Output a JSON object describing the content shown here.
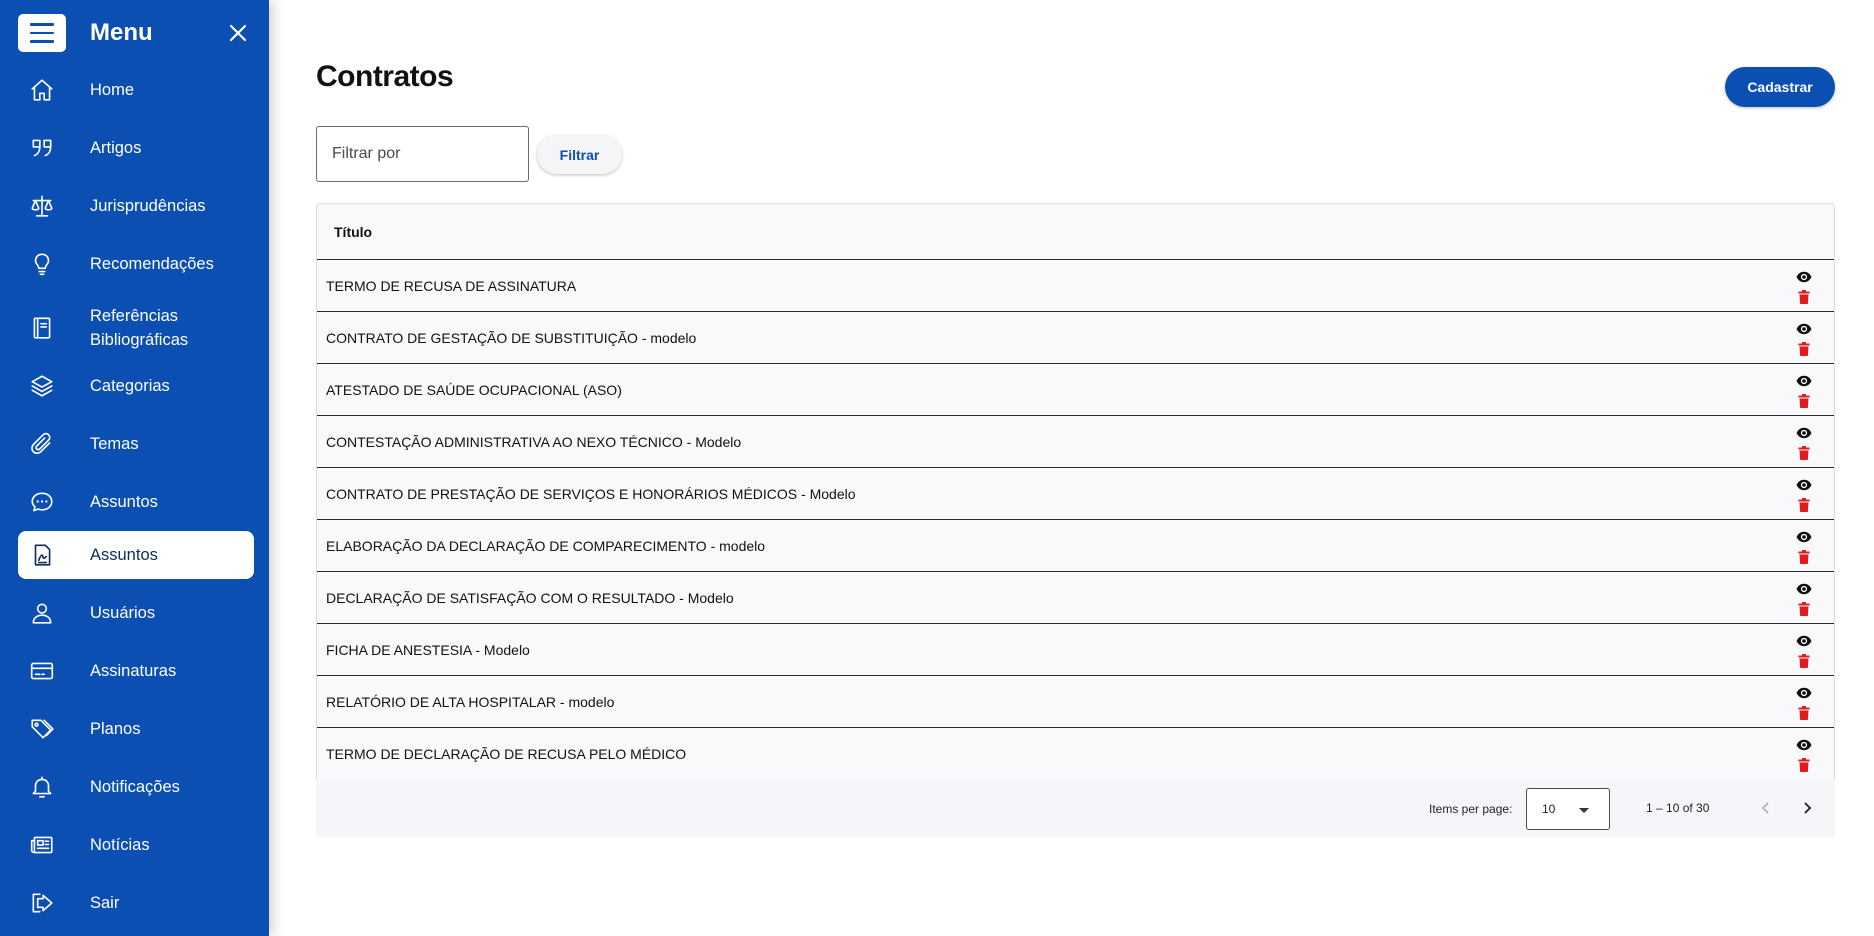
{
  "sidebar": {
    "title": "Menu",
    "items": [
      {
        "label": "Home",
        "icon": "home-icon"
      },
      {
        "label": "Artigos",
        "icon": "quote-icon"
      },
      {
        "label": "Jurisprudências",
        "icon": "scale-icon"
      },
      {
        "label": "Recomendações",
        "icon": "lightbulb-icon"
      },
      {
        "label": "Referências Bibliográficas",
        "icon": "book-icon"
      },
      {
        "label": "Categorias",
        "icon": "layers-icon"
      },
      {
        "label": "Temas",
        "icon": "paperclip-icon"
      },
      {
        "label": "Assuntos",
        "icon": "chat-bubble-icon"
      },
      {
        "label": "Assuntos",
        "icon": "document-icon",
        "active": true
      },
      {
        "label": "Usuários",
        "icon": "user-icon"
      },
      {
        "label": "Assinaturas",
        "icon": "credit-card-icon"
      },
      {
        "label": "Planos",
        "icon": "tags-icon"
      },
      {
        "label": "Notificações",
        "icon": "bell-icon"
      },
      {
        "label": "Notícias",
        "icon": "newspaper-icon"
      },
      {
        "label": "Sair",
        "icon": "logout-icon"
      }
    ]
  },
  "header": {
    "title": "Contratos",
    "add_label": "Cadastrar"
  },
  "filter": {
    "placeholder": "Filtrar por",
    "value": "",
    "button_label": "Filtrar"
  },
  "table": {
    "columns": [
      "Título"
    ],
    "rows": [
      "TERMO DE RECUSA DE ASSINATURA",
      "CONTRATO DE GESTAÇÃO DE SUBSTITUIÇÃO - modelo",
      "ATESTADO DE SAÚDE OCUPACIONAL (ASO)",
      "CONTESTAÇÃO ADMINISTRATIVA AO NEXO TÉCNICO - Modelo",
      "CONTRATO DE PRESTAÇÃO DE SERVIÇOS E HONORÁRIOS MÉDICOS - Modelo",
      "ELABORAÇÃO DA DECLARAÇÃO DE COMPARECIMENTO - modelo",
      "DECLARAÇÃO DE SATISFAÇÃO COM O RESULTADO - Modelo",
      "FICHA DE ANESTESIA - Modelo",
      "RELATÓRIO DE ALTA HOSPITALAR - modelo",
      "TERMO DE DECLARAÇÃO DE RECUSA PELO MÉDICO"
    ]
  },
  "paginator": {
    "items_per_page_label": "Items per page:",
    "page_size": "10",
    "range_label": "1 – 10 of 30"
  },
  "colors": {
    "primary": "#0b4fb3",
    "delete": "#e01b1b"
  }
}
